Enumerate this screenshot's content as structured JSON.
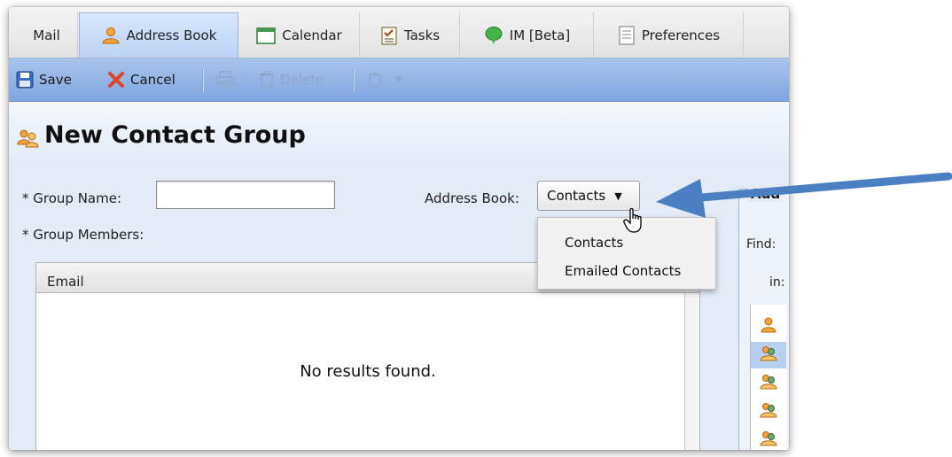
{
  "tabs": [
    {
      "label": "Mail",
      "icon": "none"
    },
    {
      "label": "Address Book",
      "icon": "person-icon"
    },
    {
      "label": "Calendar",
      "icon": "calendar-icon"
    },
    {
      "label": "Tasks",
      "icon": "checklist-icon"
    },
    {
      "label": "IM [Beta]",
      "icon": "speech-bubble-icon"
    },
    {
      "label": "Preferences",
      "icon": "preferences-icon"
    }
  ],
  "active_tab": "Address Book",
  "toolbar": {
    "save_label": "Save",
    "cancel_label": "Cancel",
    "delete_label": "Delete"
  },
  "page": {
    "title": "New Contact Group"
  },
  "form": {
    "group_name_label": "* Group Name:",
    "group_name_value": "",
    "address_book_label": "Address Book:",
    "address_book_value": "Contacts",
    "group_members_label": "* Group Members:"
  },
  "address_book_options": [
    "Contacts",
    "Emailed Contacts"
  ],
  "members_table": {
    "column_header": "Email",
    "empty_message": "No results found."
  },
  "side_panel": {
    "title": "Add",
    "find_label": "Find:",
    "in_label": "in:"
  },
  "colors": {
    "annotation_arrow": "#4a7fc1",
    "toolbar": "#8fb0e4",
    "selected_row": "#b8d0f0"
  }
}
